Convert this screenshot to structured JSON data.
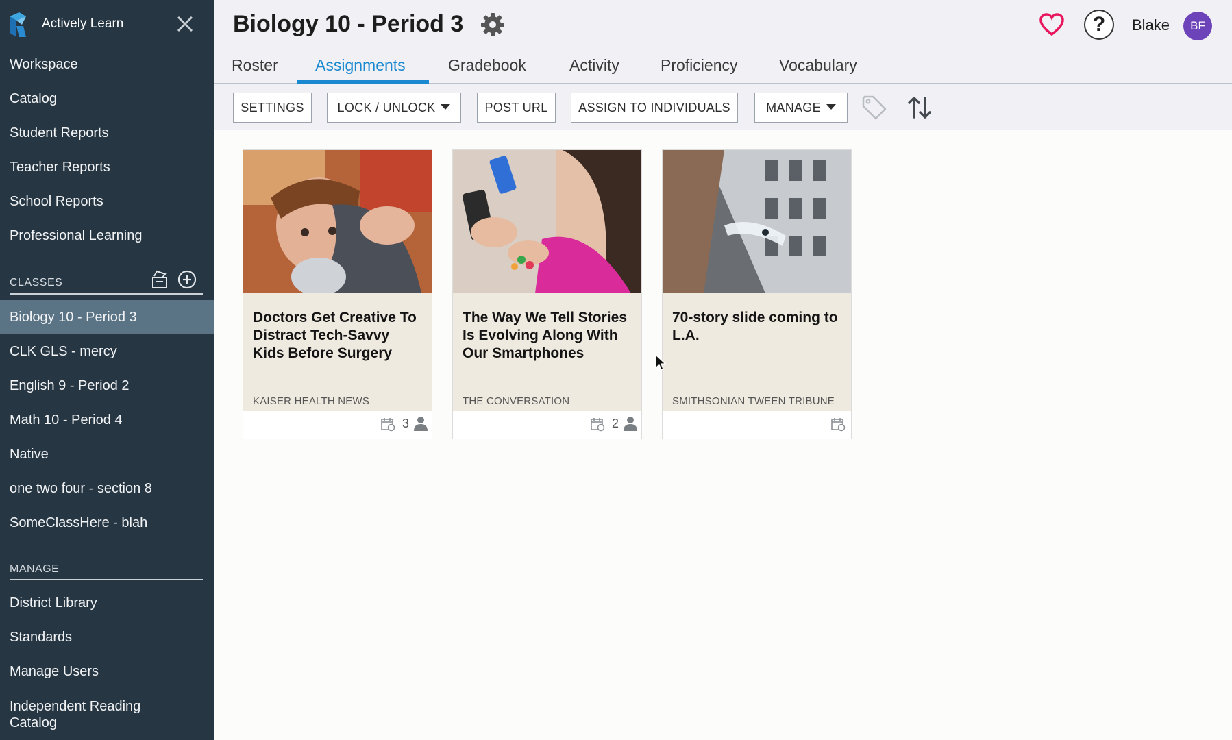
{
  "app": {
    "name": "Actively Learn"
  },
  "sidebar": {
    "nav": [
      "Workspace",
      "Catalog",
      "Student Reports",
      "Teacher Reports",
      "School Reports",
      "Professional Learning"
    ],
    "classes_label": "CLASSES",
    "classes": [
      "Biology 10 - Period 3",
      "CLK GLS - mercy",
      "English 9 - Period 2",
      "Math 10 - Period 4",
      "Native",
      "one two four - section 8",
      "SomeClassHere - blah"
    ],
    "active_class": "Biology 10 - Period 3",
    "manage_label": "MANAGE",
    "manage": [
      "District Library",
      "Standards",
      "Manage Users",
      "Independent Reading\nCatalog"
    ]
  },
  "header": {
    "title": "Biology 10 - Period 3",
    "user_name": "Blake",
    "avatar_initials": "BF",
    "help_glyph": "?",
    "tabs": [
      "Roster",
      "Assignments",
      "Gradebook",
      "Activity",
      "Proficiency",
      "Vocabulary"
    ],
    "active_tab": "Assignments"
  },
  "toolbar": {
    "settings": "SETTINGS",
    "lock_unlock": "LOCK / UNLOCK",
    "post_url": "POST URL",
    "assign_individuals": "ASSIGN TO INDIVIDUALS",
    "manage": "MANAGE"
  },
  "cards": [
    {
      "title": "Doctors Get Creative To Distract Tech-Savvy Kids Before Surgery",
      "source": "KAISER HEALTH NEWS",
      "assigned_count": "3"
    },
    {
      "title": "The Way We Tell Stories Is Evolving Along With Our Smartphones",
      "source": "THE CONVERSATION",
      "assigned_count": "2"
    },
    {
      "title": "70-story slide coming to L.A.",
      "source": "SMITHSONIAN TWEEN TRIBUNE",
      "assigned_count": ""
    }
  ],
  "colors": {
    "sidebar_bg": "#263643",
    "sidebar_active": "#5b7485",
    "accent": "#1a89d0",
    "heart": "#e8175d",
    "avatar": "#6d43b9",
    "card_info_bg": "#efeadf"
  },
  "icons": [
    "logo-icon",
    "close-icon",
    "archive-icon",
    "add-circle-icon",
    "gear-icon",
    "heart-icon",
    "help-icon",
    "tag-icon",
    "sort-icon",
    "calendar-icon",
    "person-icon"
  ]
}
